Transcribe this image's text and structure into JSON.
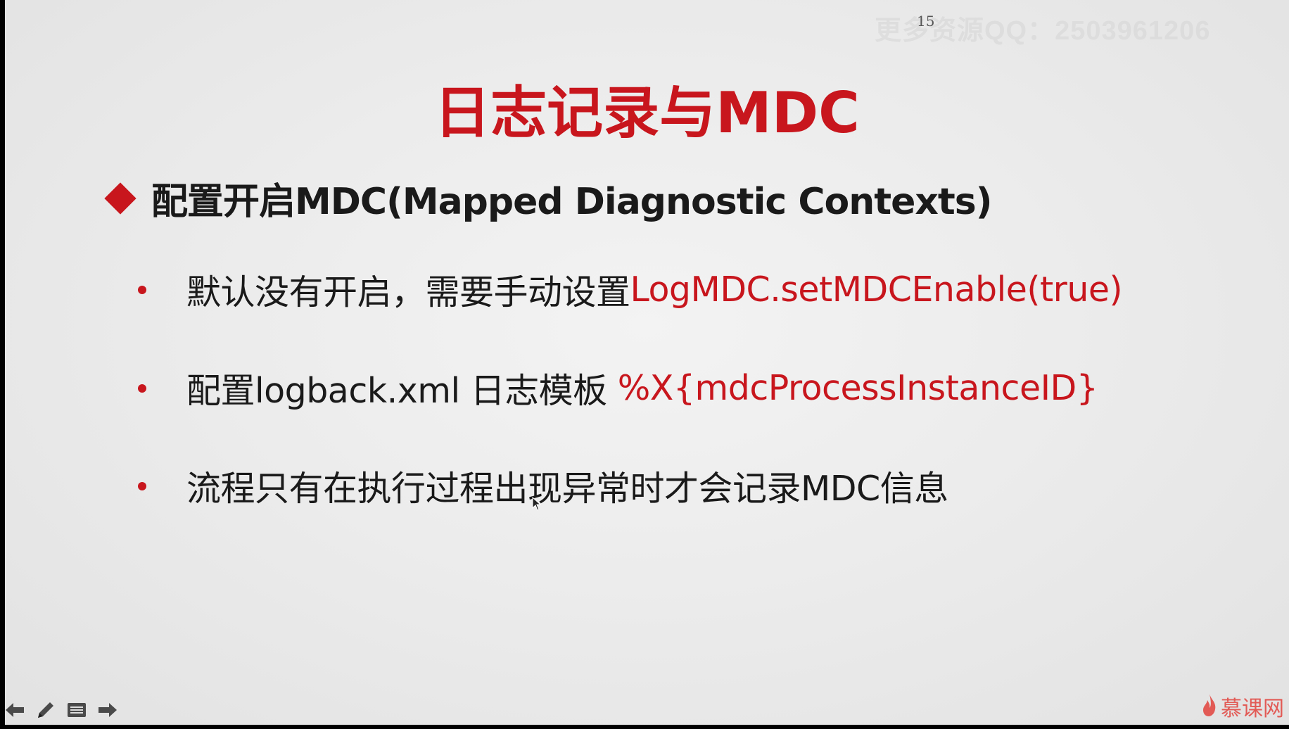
{
  "slide": {
    "page_number": "15",
    "watermark": "更多资源QQ：2503961206",
    "title": "日志记录与MDC",
    "heading": "配置开启MDC(Mapped Diagnostic Contexts)",
    "bullets": [
      {
        "text": "默认没有开启，需要手动设置",
        "code": "LogMDC.setMDCEnable(true)"
      },
      {
        "text": "配置logback.xml 日志模板 ",
        "code": "%X{mdcProcessInstanceID}"
      },
      {
        "text": "流程只有在执行过程出现异常时才会记录MDC信息",
        "code": ""
      }
    ]
  },
  "toolbar": {
    "icons": [
      "arrow-left-icon",
      "pen-icon",
      "menu-icon",
      "arrow-right-icon"
    ]
  },
  "logo": {
    "text": "慕课网",
    "icon": "flame-icon"
  },
  "colors": {
    "accent": "#c8161d",
    "text": "#1a1a1a",
    "background": "#ececec"
  }
}
